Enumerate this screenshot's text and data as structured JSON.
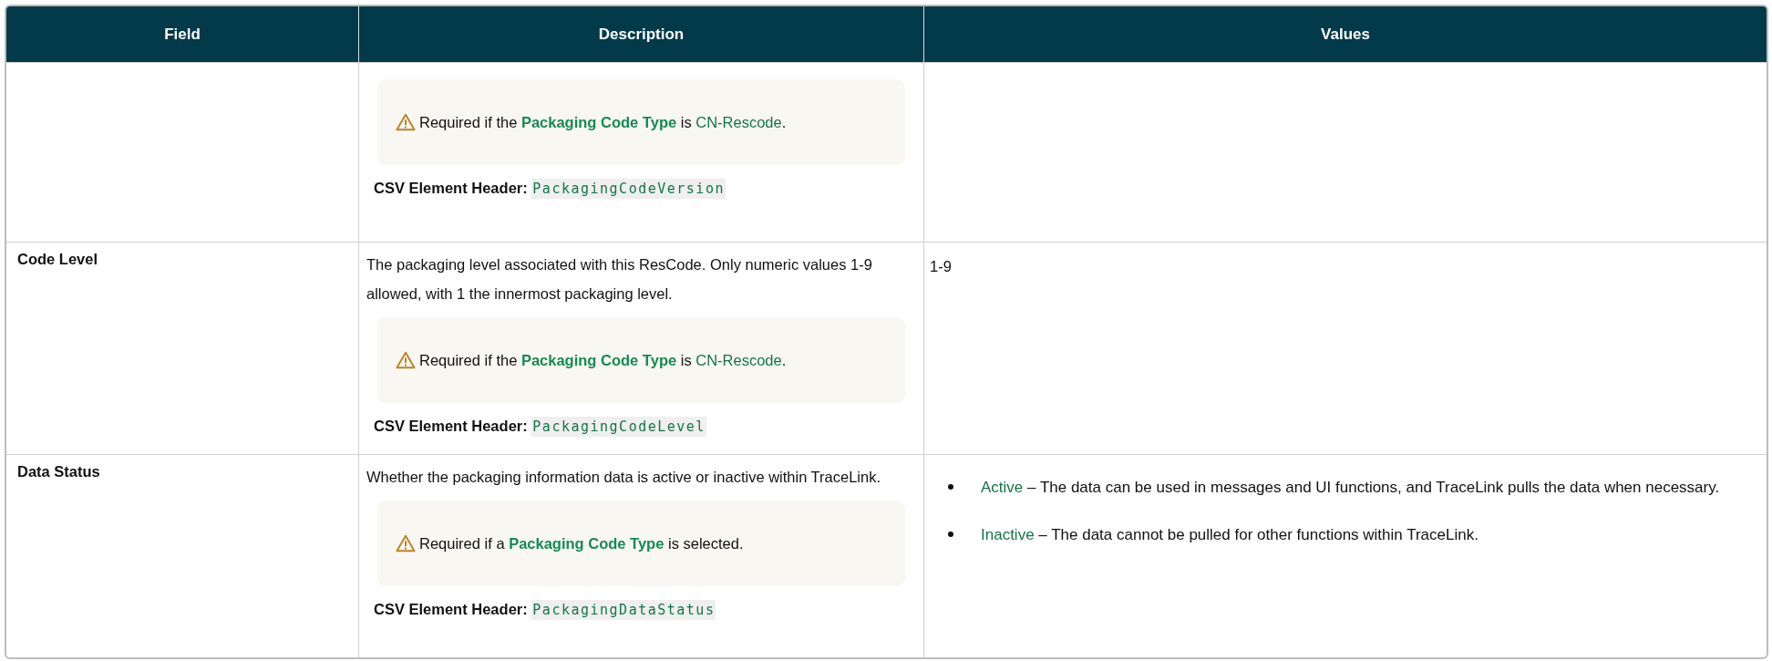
{
  "table": {
    "columns": [
      "Field",
      "Description",
      "Values"
    ],
    "rows": [
      {
        "field": "",
        "description": "",
        "note": [
          {
            "kind": "plain",
            "text": "Required if the "
          },
          {
            "kind": "term",
            "text": "Packaging Code Type"
          },
          {
            "kind": "plain",
            "text": " is "
          },
          {
            "kind": "value",
            "text": "CN-Rescode"
          },
          {
            "kind": "plain",
            "text": "."
          }
        ],
        "csv_label": "CSV Element Header:",
        "csv_code": "PackagingCodeVersion",
        "values": []
      },
      {
        "field": "Code Level",
        "description": "The packaging level associated with this ResCode. Only numeric values 1-9 allowed, with 1 the innermost packaging level.",
        "note": [
          {
            "kind": "plain",
            "text": "Required if the "
          },
          {
            "kind": "term",
            "text": "Packaging Code Type"
          },
          {
            "kind": "plain",
            "text": " is "
          },
          {
            "kind": "value",
            "text": "CN-Rescode"
          },
          {
            "kind": "plain",
            "text": "."
          }
        ],
        "csv_label": "CSV Element Header:",
        "csv_code": "PackagingCodeLevel",
        "values": [
          {
            "kind": "text",
            "text": "1-9"
          }
        ]
      },
      {
        "field": "Data Status",
        "description": "Whether the packaging information data is active or inactive within TraceLink.",
        "note": [
          {
            "kind": "plain",
            "text": "Required if a "
          },
          {
            "kind": "term",
            "text": "Packaging Code Type"
          },
          {
            "kind": "plain",
            "text": " is selected."
          }
        ],
        "csv_label": "CSV Element Header:",
        "csv_code": "PackagingDataStatus",
        "values": [
          {
            "kind": "bullet",
            "term": "Active",
            "text": " – The data can be used in messages and UI functions, and TraceLink pulls the data when necessary."
          },
          {
            "kind": "bullet",
            "term": "Inactive",
            "text": " – The data cannot be pulled for other functions within TraceLink."
          }
        ]
      }
    ]
  }
}
